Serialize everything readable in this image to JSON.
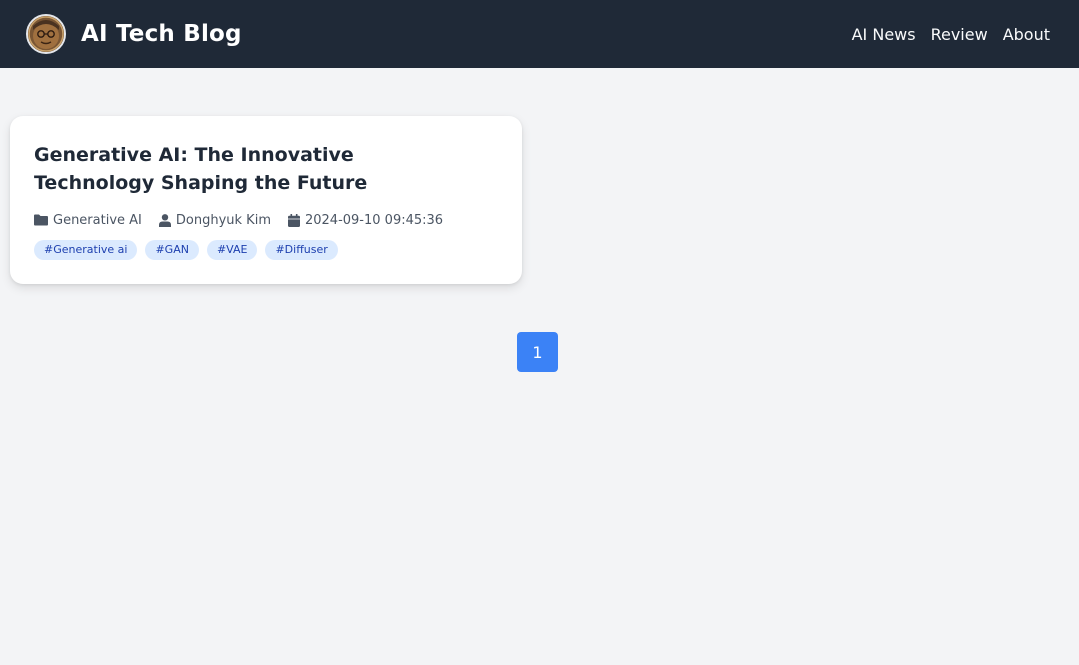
{
  "header": {
    "avatar_icon": "profile-avatar",
    "brand_title": "AI Tech Blog",
    "nav": [
      {
        "label": "AI News"
      },
      {
        "label": "Review"
      },
      {
        "label": "About"
      }
    ],
    "background_color": "#1f2937"
  },
  "posts": [
    {
      "title": "Generative AI: The Innovative Technology Shaping the Future",
      "category": "Generative AI",
      "category_icon": "folder-icon",
      "author": "Donghyuk Kim",
      "author_icon": "user-icon",
      "date": "2024-09-10 09:45:36",
      "date_icon": "calendar-icon",
      "tags": [
        "#Generative ai",
        "#GAN",
        "#VAE",
        "#Diffuser"
      ]
    }
  ],
  "pagination": {
    "pages": [
      "1"
    ],
    "current": "1",
    "accent_color": "#3b82f6"
  }
}
